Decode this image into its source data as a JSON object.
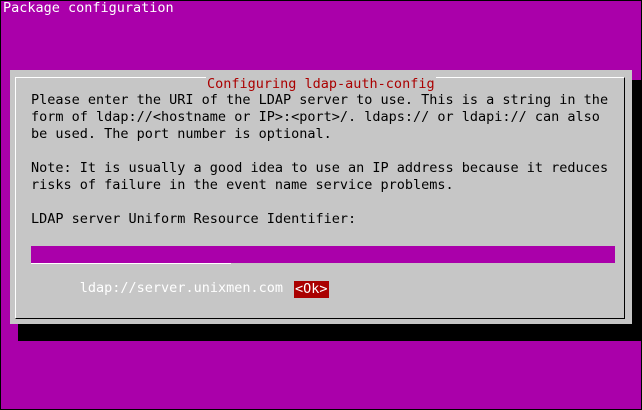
{
  "screen": {
    "title": "Package configuration"
  },
  "dialog": {
    "title": "Configuring ldap-auth-config",
    "lines": [
      "Please enter the URI of the LDAP server to use. This is a string in the",
      "form of ldap://<hostname or IP>:<port>/. ldaps:// or ldapi:// can also",
      "be used. The port number is optional.",
      "",
      "Note: It is usually a good idea to use an IP address because it reduces",
      "risks of failure in the event name service problems.",
      "",
      "LDAP server Uniform Resource Identifier:"
    ],
    "input_value": "ldap://server.unixmen.com",
    "ok_label": "<Ok>"
  },
  "colors": {
    "background": "#aa00aa",
    "dialog": "#c6c6c6",
    "accent": "#aa0000"
  }
}
